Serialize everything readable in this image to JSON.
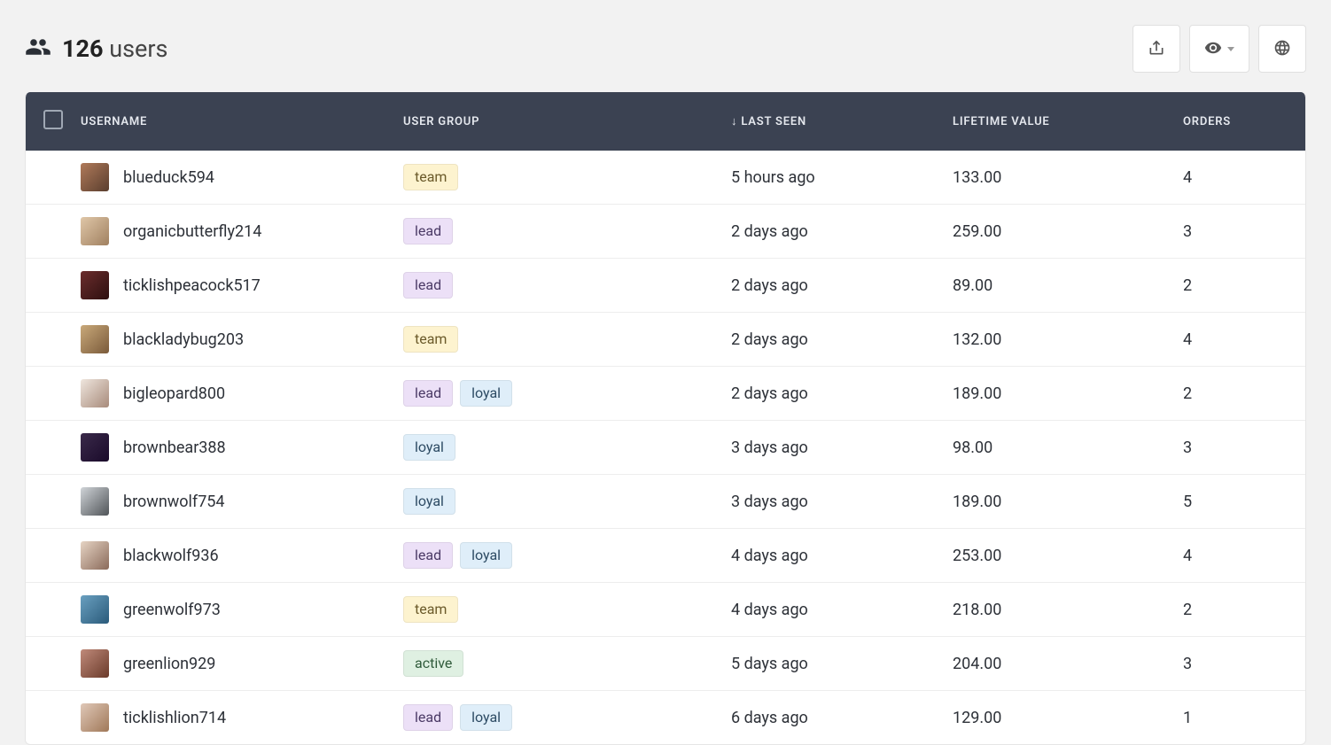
{
  "header": {
    "count": "126",
    "label": "users"
  },
  "toolbar": {
    "export_icon": "export-icon",
    "visibility_icon": "eye-icon",
    "globe_icon": "globe-icon"
  },
  "table": {
    "columns": {
      "username": "USERNAME",
      "user_group": "USER GROUP",
      "last_seen": "LAST SEEN",
      "last_seen_sort_indicator": "↓",
      "lifetime_value": "LIFETIME VALUE",
      "orders": "ORDERS"
    },
    "rows": [
      {
        "username": "blueduck594",
        "avatar_colors": [
          "#b07a5a",
          "#5a3e2e"
        ],
        "groups": [
          "team"
        ],
        "last_seen": "5 hours ago",
        "lifetime_value": "133.00",
        "orders": "4"
      },
      {
        "username": "organicbutterfly214",
        "avatar_colors": [
          "#e0c7a8",
          "#a08060"
        ],
        "groups": [
          "lead"
        ],
        "last_seen": "2 days ago",
        "lifetime_value": "259.00",
        "orders": "3"
      },
      {
        "username": "ticklishpeacock517",
        "avatar_colors": [
          "#6b2d2d",
          "#2d0f0f"
        ],
        "groups": [
          "lead"
        ],
        "last_seen": "2 days ago",
        "lifetime_value": "89.00",
        "orders": "2"
      },
      {
        "username": "blackladybug203",
        "avatar_colors": [
          "#c9a97a",
          "#7a5a3a"
        ],
        "groups": [
          "team"
        ],
        "last_seen": "2 days ago",
        "lifetime_value": "132.00",
        "orders": "4"
      },
      {
        "username": "bigleopard800",
        "avatar_colors": [
          "#efe6de",
          "#a78a7a"
        ],
        "groups": [
          "lead",
          "loyal"
        ],
        "last_seen": "2 days ago",
        "lifetime_value": "189.00",
        "orders": "2"
      },
      {
        "username": "brownbear388",
        "avatar_colors": [
          "#3a2a4a",
          "#1a0a2a"
        ],
        "groups": [
          "loyal"
        ],
        "last_seen": "3 days ago",
        "lifetime_value": "98.00",
        "orders": "3"
      },
      {
        "username": "brownwolf754",
        "avatar_colors": [
          "#d0d4d8",
          "#505458"
        ],
        "groups": [
          "loyal"
        ],
        "last_seen": "3 days ago",
        "lifetime_value": "189.00",
        "orders": "5"
      },
      {
        "username": "blackwolf936",
        "avatar_colors": [
          "#e6d4c4",
          "#8a6a5a"
        ],
        "groups": [
          "lead",
          "loyal"
        ],
        "last_seen": "4 days ago",
        "lifetime_value": "253.00",
        "orders": "4"
      },
      {
        "username": "greenwolf973",
        "avatar_colors": [
          "#6aa0c0",
          "#2a5a7a"
        ],
        "groups": [
          "team"
        ],
        "last_seen": "4 days ago",
        "lifetime_value": "218.00",
        "orders": "2"
      },
      {
        "username": "greenlion929",
        "avatar_colors": [
          "#c08a7a",
          "#6a3a2a"
        ],
        "groups": [
          "active"
        ],
        "last_seen": "5 days ago",
        "lifetime_value": "204.00",
        "orders": "3"
      },
      {
        "username": "ticklishlion714",
        "avatar_colors": [
          "#e0c8b8",
          "#a07858"
        ],
        "groups": [
          "lead",
          "loyal"
        ],
        "last_seen": "6 days ago",
        "lifetime_value": "129.00",
        "orders": "1"
      }
    ]
  }
}
